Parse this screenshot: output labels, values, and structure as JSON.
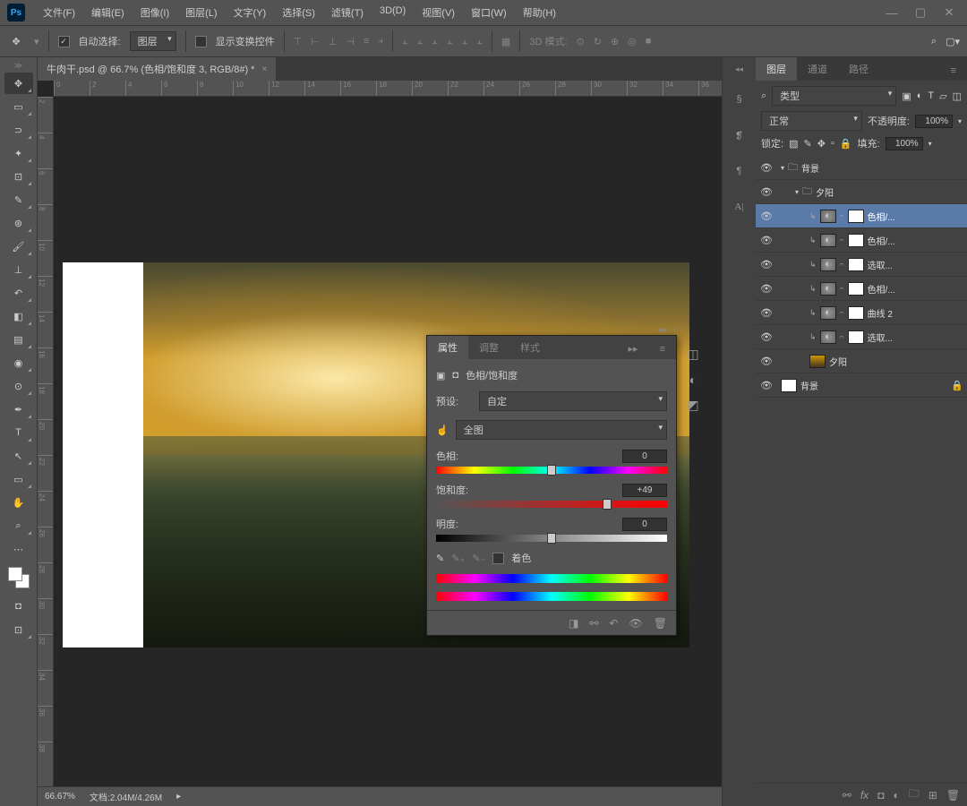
{
  "menu": {
    "file": "文件(F)",
    "edit": "编辑(E)",
    "image": "图像(I)",
    "layer": "图层(L)",
    "type": "文字(Y)",
    "select": "选择(S)",
    "filter": "滤镜(T)",
    "d3": "3D(D)",
    "view": "视图(V)",
    "window": "窗口(W)",
    "help": "帮助(H)"
  },
  "options": {
    "autoselect": "自动选择:",
    "layer_dd": "图层",
    "showtransform": "显示变换控件",
    "mode3d": "3D 模式:"
  },
  "doc": {
    "tab": "牛肉干.psd @ 66.7% (色相/饱和度 3, RGB/8#) *"
  },
  "status": {
    "zoom": "66.67%",
    "docinfo": "文档:2.04M/4.26M"
  },
  "panels": {
    "layers": "图层",
    "channels": "通道",
    "paths": "路径"
  },
  "layer_opts": {
    "kind": "类型",
    "blend": "正常",
    "opacity_lbl": "不透明度:",
    "opacity": "100%",
    "lock_lbl": "锁定:",
    "fill_lbl": "填充:",
    "fill": "100%"
  },
  "layers": [
    {
      "name": "背景",
      "type": "group",
      "indent": 0
    },
    {
      "name": "夕阳",
      "type": "group",
      "indent": 1
    },
    {
      "name": "色相/...",
      "type": "hsl",
      "indent": 2,
      "selected": true
    },
    {
      "name": "色相/...",
      "type": "hsl",
      "indent": 2
    },
    {
      "name": "选取...",
      "type": "hsl",
      "indent": 2
    },
    {
      "name": "色相/...",
      "type": "hsl",
      "indent": 2
    },
    {
      "name": "曲线 2",
      "type": "hsl",
      "indent": 2
    },
    {
      "name": "选取...",
      "type": "hsl",
      "indent": 2
    },
    {
      "name": "夕阳",
      "type": "image",
      "indent": 2
    },
    {
      "name": "背景",
      "type": "bg",
      "indent": 0,
      "locked": true
    }
  ],
  "props": {
    "tabs": {
      "properties": "属性",
      "adjust": "调整",
      "styles": "样式"
    },
    "title": "色相/饱和度",
    "preset_lbl": "预设:",
    "preset": "自定",
    "range": "全图",
    "hue_lbl": "色相:",
    "hue": "0",
    "sat_lbl": "饱和度:",
    "sat": "+49",
    "lit_lbl": "明度:",
    "lit": "0",
    "colorize": "着色"
  },
  "ruler_h": [
    "0",
    "2",
    "4",
    "6",
    "8",
    "10",
    "12",
    "14",
    "16",
    "18",
    "20",
    "22",
    "24",
    "26",
    "28",
    "30",
    "32",
    "34",
    "36"
  ],
  "ruler_v": [
    "2",
    "4",
    "6",
    "8",
    "10",
    "12",
    "14",
    "16",
    "18",
    "20",
    "22",
    "24",
    "26",
    "28",
    "30",
    "32",
    "34",
    "36",
    "38"
  ]
}
